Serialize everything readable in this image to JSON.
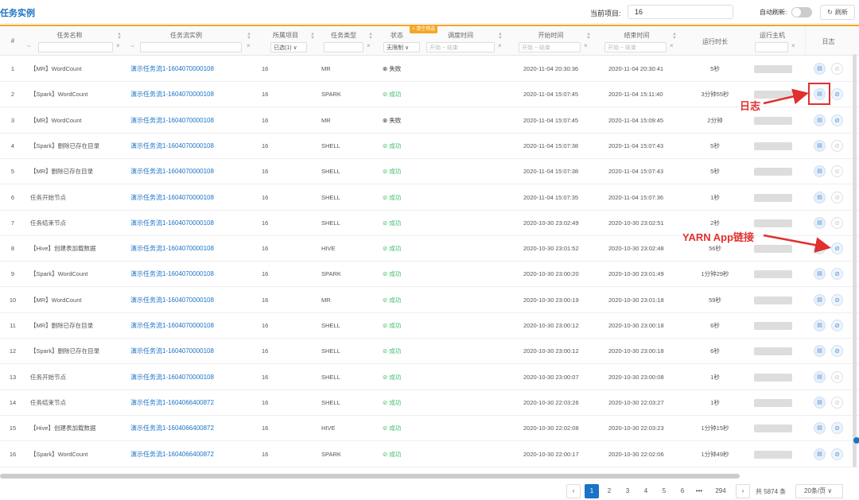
{
  "header": {
    "title": "任务实例",
    "project_label": "当前项目:",
    "project_value": "16",
    "auto_refresh_label": "自动刷新:",
    "refresh_label": "刷新"
  },
  "columns": {
    "idx": "#",
    "name": "任务名称",
    "flow": "任务流实例",
    "project": "所属项目",
    "type": "任务类型",
    "status": "状态",
    "schedule": "调度时间",
    "start": "开始时间",
    "end": "结束时间",
    "duration": "运行时长",
    "host": "运行主机",
    "log": "日志"
  },
  "filters": {
    "project_value": "已选(1)",
    "status_value": "无限制",
    "clear_label": "清空筛选",
    "range_start": "开始",
    "range_end": "结束"
  },
  "rows": [
    {
      "idx": "1",
      "name": "【MR】WordCount",
      "flow": "演示任务流1-1604070000108",
      "project": "16",
      "type": "MR",
      "status": "失败",
      "start": "2020-11-04 20:30:36",
      "end": "2020-11-04 20:30:41",
      "duration": "5秒"
    },
    {
      "idx": "2",
      "name": "【Spark】WordCount",
      "flow": "演示任务流1-1604070000108",
      "project": "16",
      "type": "SPARK",
      "status": "成功",
      "start": "2020-11-04 15:07:45",
      "end": "2020-11-04 15:11:40",
      "duration": "3分钟55秒"
    },
    {
      "idx": "3",
      "name": "【MR】WordCount",
      "flow": "演示任务流1-1604070000108",
      "project": "16",
      "type": "MR",
      "status": "失败",
      "start": "2020-11-04 15:07:45",
      "end": "2020-11-04 15:09:45",
      "duration": "2分钟"
    },
    {
      "idx": "4",
      "name": "【Spark】删除已存在目录",
      "flow": "演示任务流1-1604070000108",
      "project": "16",
      "type": "SHELL",
      "status": "成功",
      "start": "2020-11-04 15:07:38",
      "end": "2020-11-04 15:07:43",
      "duration": "5秒"
    },
    {
      "idx": "5",
      "name": "【MR】删除已存在目录",
      "flow": "演示任务流1-1604070000108",
      "project": "16",
      "type": "SHELL",
      "status": "成功",
      "start": "2020-11-04 15:07:38",
      "end": "2020-11-04 15:07:43",
      "duration": "5秒"
    },
    {
      "idx": "6",
      "name": "任务开始节点",
      "flow": "演示任务流1-1604070000108",
      "project": "16",
      "type": "SHELL",
      "status": "成功",
      "start": "2020-11-04 15:07:35",
      "end": "2020-11-04 15:07:36",
      "duration": "1秒"
    },
    {
      "idx": "7",
      "name": "任务结束节点",
      "flow": "演示任务流1-1604070000108",
      "project": "16",
      "type": "SHELL",
      "status": "成功",
      "start": "2020-10-30 23:02:49",
      "end": "2020-10-30 23:02:51",
      "duration": "2秒"
    },
    {
      "idx": "8",
      "name": "【Hive】创建表加载数据",
      "flow": "演示任务流1-1604070000108",
      "project": "16",
      "type": "HIVE",
      "status": "成功",
      "start": "2020-10-30 23:01:52",
      "end": "2020-10-30 23:02:48",
      "duration": "56秒"
    },
    {
      "idx": "9",
      "name": "【Spark】WordCount",
      "flow": "演示任务流1-1604070000108",
      "project": "16",
      "type": "SPARK",
      "status": "成功",
      "start": "2020-10-30 23:00:20",
      "end": "2020-10-30 23:01:49",
      "duration": "1分钟29秒"
    },
    {
      "idx": "10",
      "name": "【MR】WordCount",
      "flow": "演示任务流1-1604070000108",
      "project": "16",
      "type": "MR",
      "status": "成功",
      "start": "2020-10-30 23:00:19",
      "end": "2020-10-30 23:01:18",
      "duration": "59秒"
    },
    {
      "idx": "11",
      "name": "【MR】删除已存在目录",
      "flow": "演示任务流1-1604070000108",
      "project": "16",
      "type": "SHELL",
      "status": "成功",
      "start": "2020-10-30 23:00:12",
      "end": "2020-10-30 23:00:18",
      "duration": "6秒"
    },
    {
      "idx": "12",
      "name": "【Spark】删除已存在目录",
      "flow": "演示任务流1-1604070000108",
      "project": "16",
      "type": "SHELL",
      "status": "成功",
      "start": "2020-10-30 23:00:12",
      "end": "2020-10-30 23:00:18",
      "duration": "6秒"
    },
    {
      "idx": "13",
      "name": "任务开始节点",
      "flow": "演示任务流1-1604070000108",
      "project": "16",
      "type": "SHELL",
      "status": "成功",
      "start": "2020-10-30 23:00:07",
      "end": "2020-10-30 23:00:08",
      "duration": "1秒"
    },
    {
      "idx": "14",
      "name": "任务结束节点",
      "flow": "演示任务流1-1604066400872",
      "project": "16",
      "type": "SHELL",
      "status": "成功",
      "start": "2020-10-30 22:03:26",
      "end": "2020-10-30 22:03:27",
      "duration": "1秒"
    },
    {
      "idx": "15",
      "name": "【Hive】创建表加载数据",
      "flow": "演示任务流1-1604066400872",
      "project": "16",
      "type": "HIVE",
      "status": "成功",
      "start": "2020-10-30 22:02:08",
      "end": "2020-10-30 22:03:23",
      "duration": "1分钟15秒"
    },
    {
      "idx": "16",
      "name": "【Spark】WordCount",
      "flow": "演示任务流1-1604066400872",
      "project": "16",
      "type": "SPARK",
      "status": "成功",
      "start": "2020-10-30 22:00:17",
      "end": "2020-10-30 22:02:06",
      "duration": "1分钟49秒"
    }
  ],
  "annotations": {
    "log": "日志",
    "yarn": "YARN App链接"
  },
  "pagination": {
    "pages": [
      "1",
      "2",
      "3",
      "4",
      "5",
      "6"
    ],
    "ellipsis": "•••",
    "last": "294",
    "total": "共 5874 条",
    "page_size": "20条/页",
    "current": "1"
  },
  "colors": {
    "accent": "#1a73c7",
    "success": "#3bbf6b",
    "annotation": "#e0302f",
    "filter_tag": "#f5a623"
  }
}
